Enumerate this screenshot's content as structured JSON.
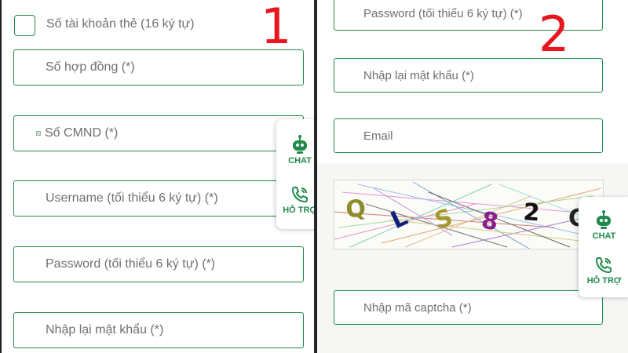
{
  "left": {
    "step": "1",
    "checkbox_label": "Số tài khoản thẻ (16 ký tự)",
    "fields": [
      "Số hợp đồng (*)",
      "Số CMND (*)",
      "Username (tối thiểu 6 ký tự) (*)",
      "Password (tối thiểu 6 ký tự) (*)",
      "Nhập lại mật khẩu (*)"
    ]
  },
  "right": {
    "step": "2",
    "fields": [
      "Password (tối thiểu 6 ký tự) (*)",
      "Nhập lại mật khẩu (*)",
      "Email"
    ],
    "captcha": {
      "chars": [
        "Q",
        "L",
        "S",
        "8",
        "2",
        "C"
      ],
      "colors": [
        "#8c8c2a",
        "#10207a",
        "#a3992f",
        "#8a1e8a",
        "#111111",
        "#222222"
      ]
    },
    "captcha_input": "Nhập mã captcha (*)"
  },
  "widget": {
    "chat_label": "CHAT",
    "support_label": "HỖ TRỢ",
    "accent": "#1f8a4c"
  },
  "colors": {
    "border": "#1f8a4c",
    "step_number": "#e8161e",
    "placeholder": "#707070"
  }
}
